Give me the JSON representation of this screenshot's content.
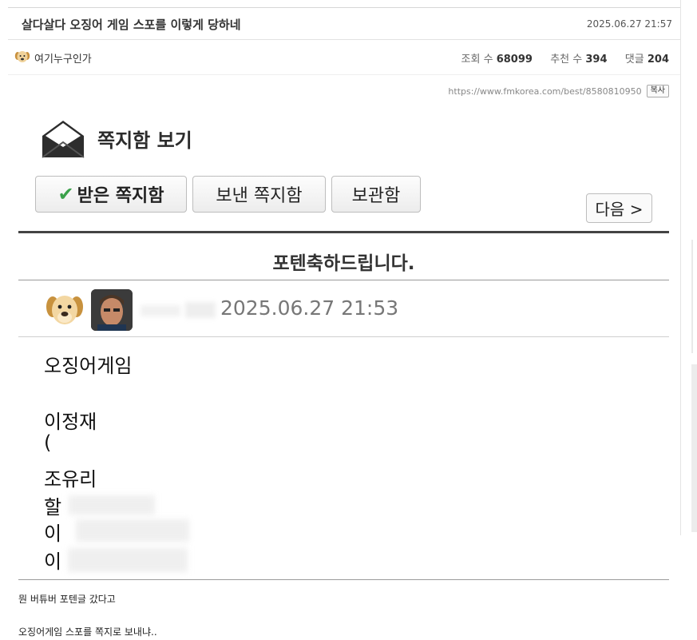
{
  "post": {
    "title": "살다살다 오징어 게임 스포를 이렇게 당하네",
    "date": "2025.06.27 21:57",
    "author": "여기누구인가",
    "views_label": "조회 수",
    "views": "68099",
    "recommend_label": "추천 수",
    "recommend": "394",
    "comments_label": "댓글",
    "comments": "204",
    "url": "https://www.fmkorea.com/best/8580810950",
    "copy_label": "복사"
  },
  "screenshot": {
    "heading": "쪽지함 보기",
    "tabs": {
      "inbox": "받은 쪽지함",
      "sent": "보낸 쪽지함",
      "storage": "보관함"
    },
    "next_label": "다음 >",
    "subject": "포텐축하드립니다.",
    "timestamp": "2025.06.27 21:53",
    "body_lines": [
      "오징어게임",
      "이정재",
      "(",
      "조유리",
      "할",
      "이",
      "이"
    ]
  },
  "caption": {
    "line1": "뭔 버튜버 포텐글 갔다고",
    "line2": "오징어게임 스포를 쪽지로 보내냐.."
  },
  "colors": {
    "check": "#3aa14a",
    "rule": "#444444",
    "timestamp": "#777777"
  },
  "icons": [
    "dog-avatar-icon",
    "envelope-icon",
    "checkmark-icon",
    "user-photo-icon"
  ]
}
